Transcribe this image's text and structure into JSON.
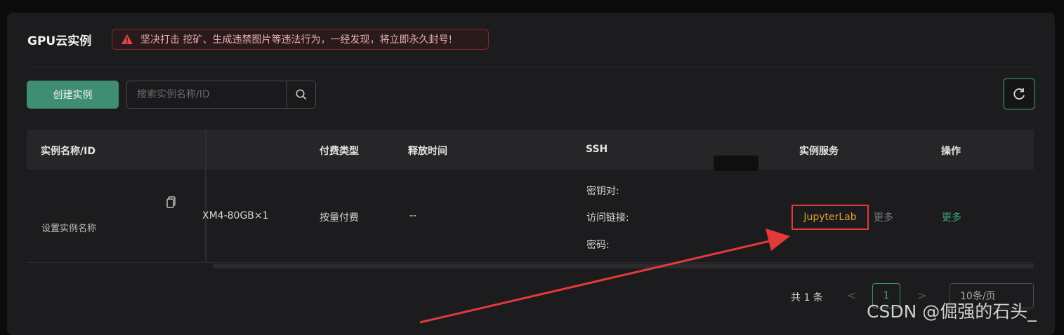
{
  "page": {
    "title": "GPU云实例",
    "warning": "坚决打击 挖矿、生成违禁图片等违法行为，一经发现，将立即永久封号!"
  },
  "toolbar": {
    "create_label": "创建实例",
    "search_placeholder": "搜索实例名称/ID",
    "search_icon": "search-icon",
    "refresh_icon": "refresh-icon"
  },
  "table": {
    "columns": [
      "实例名称/ID",
      "付费类型",
      "释放时间",
      "SSH",
      "实例服务",
      "操作"
    ],
    "rows": [
      {
        "name": "设置实例名称",
        "gpu": "XM4-80GB×1",
        "billing": "按量付费",
        "release": "--",
        "ssh": {
          "key_pair": "密钥对:",
          "access_link": "访问链接:",
          "password": "密码:"
        },
        "service": "JupyterLab",
        "service_more": "更多",
        "action_more": "更多"
      }
    ]
  },
  "pagination": {
    "total": "共 1 条",
    "prev": "<",
    "current": "1",
    "next": ">",
    "page_size": "10条/页"
  },
  "watermark": "CSDN @倔强的石头_",
  "colors": {
    "accent": "#3f8e72",
    "highlight_border": "#e23a3a",
    "service_link": "#e0a030",
    "arrow": "#e23a3a"
  }
}
